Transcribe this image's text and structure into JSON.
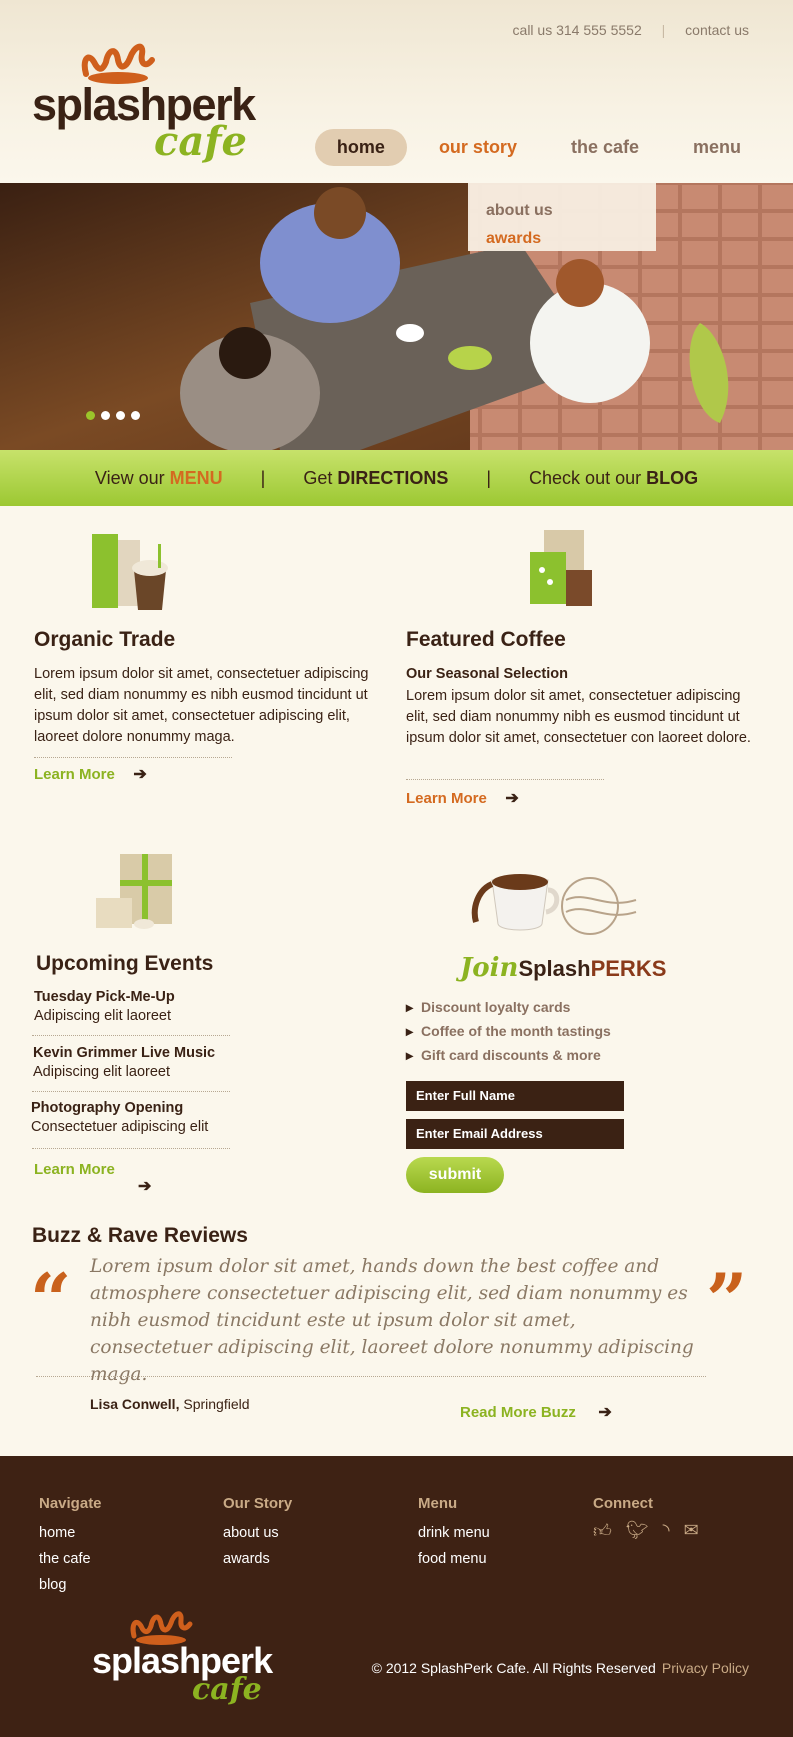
{
  "topbar": {
    "phone": "call us 314 555 5552",
    "separator": "|",
    "contact": "contact us"
  },
  "logo": {
    "word": "splashperk",
    "cafe": "cafe"
  },
  "nav": {
    "home": "home",
    "our_story": "our story",
    "the_cafe": "the cafe",
    "menu": "menu"
  },
  "dropdown": {
    "about": "about us",
    "awards": "awards"
  },
  "greenbar": {
    "view_pre": "View our ",
    "view_key": "MENU",
    "get_pre": "Get ",
    "get_key": "DIRECTIONS",
    "check_pre": "Check out our ",
    "check_key": "BLOG",
    "separator": "|"
  },
  "organic": {
    "title": "Organic Trade",
    "body": "Lorem ipsum dolor sit amet, consectetuer adipiscing elit, sed diam nonummy es nibh eusmod tincidunt ut ipsum dolor sit amet, consectetuer adipiscing elit, laoreet dolore nonummy maga.",
    "learn": "Learn More"
  },
  "featured": {
    "title": "Featured Coffee",
    "subtitle": "Our Seasonal Selection",
    "body": "Lorem ipsum dolor sit amet, consectetuer adipiscing elit, sed diam nonummy nibh es eusmod tincidunt ut ipsum dolor sit amet, consectetuer con laoreet dolore.",
    "learn": "Learn More"
  },
  "events": {
    "title": "Upcoming Events",
    "items": [
      {
        "title": "Tuesday Pick-Me-Up",
        "sub": "Adipiscing elit laoreet"
      },
      {
        "title": "Kevin Grimmer Live Music",
        "sub": "Adipiscing elit laoreet"
      },
      {
        "title": "Photography Opening",
        "sub": "Consectetuer adipiscing elit"
      }
    ],
    "learn": "Learn More"
  },
  "join": {
    "join_word": "Join",
    "splash": "Splash",
    "perks": "PERKS",
    "bullets": [
      "Discount loyalty cards",
      "Coffee of the month tastings",
      "Gift card discounts & more"
    ],
    "name_placeholder": "Enter Full Name",
    "email_placeholder": "Enter Email Address",
    "submit": "submit"
  },
  "reviews": {
    "title": "Buzz & Rave Reviews",
    "quote": "Lorem ipsum dolor sit amet, hands down the best coffee and atmosphere consectetuer adipiscing elit, sed diam nonummy es nibh eusmod tincidunt este ut ipsum dolor sit amet, consectetuer adipiscing elit, laoreet dolore nonummy adipiscing maga.",
    "author": "Lisa Conwell,",
    "location": "Springfield",
    "read_more": "Read More Buzz"
  },
  "footer": {
    "navigate": {
      "heading": "Navigate",
      "links": [
        "home",
        "the cafe",
        "blog"
      ]
    },
    "our_story": {
      "heading": "Our Story",
      "links": [
        "about us",
        "awards"
      ]
    },
    "menu": {
      "heading": "Menu",
      "links": [
        "drink menu",
        "food menu"
      ]
    },
    "connect": {
      "heading": "Connect",
      "icons": [
        "thumbs-up-icon",
        "bird-icon",
        "rss-icon",
        "mail-icon"
      ]
    },
    "copyright": "© 2012 SplashPerk Cafe. All Rights Reserved",
    "privacy": "Privacy Policy"
  },
  "colors": {
    "brown": "#3b2214",
    "green": "#8cb321",
    "orange": "#d46a20",
    "cream": "#fbf7ec"
  }
}
